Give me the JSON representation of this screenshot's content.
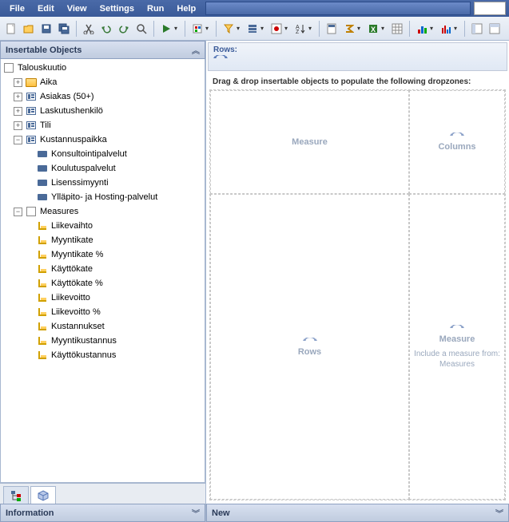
{
  "menu": [
    "File",
    "Edit",
    "View",
    "Settings",
    "Run",
    "Help"
  ],
  "panels": {
    "insertable": "Insertable Objects",
    "information": "Information",
    "new": "New"
  },
  "tree": {
    "root": "Talouskuutio",
    "items": [
      {
        "label": "Aika",
        "toggle": "+",
        "icon": "folder",
        "depth": 1
      },
      {
        "label": "Asiakas (50+)",
        "toggle": "+",
        "icon": "dim",
        "depth": 1
      },
      {
        "label": "Laskutushenkilö",
        "toggle": "+",
        "icon": "dim",
        "depth": 1
      },
      {
        "label": "Tili",
        "toggle": "+",
        "icon": "dim",
        "depth": 1
      },
      {
        "label": "Kustannuspaikka",
        "toggle": "−",
        "icon": "dim",
        "depth": 1
      },
      {
        "label": "Konsultointipalvelut",
        "toggle": "",
        "icon": "member",
        "depth": 2
      },
      {
        "label": "Koulutuspalvelut",
        "toggle": "",
        "icon": "member",
        "depth": 2
      },
      {
        "label": "Lisenssimyynti",
        "toggle": "",
        "icon": "member",
        "depth": 2
      },
      {
        "label": "Ylläpito- ja Hosting-palvelut",
        "toggle": "",
        "icon": "member",
        "depth": 2
      },
      {
        "label": "Measures",
        "toggle": "−",
        "icon": "measures",
        "depth": 1
      },
      {
        "label": "Liikevaihto",
        "toggle": "",
        "icon": "measure",
        "depth": 2
      },
      {
        "label": "Myyntikate",
        "toggle": "",
        "icon": "measure",
        "depth": 2
      },
      {
        "label": "Myyntikate %",
        "toggle": "",
        "icon": "measure",
        "depth": 2
      },
      {
        "label": "Käyttökate",
        "toggle": "",
        "icon": "measure",
        "depth": 2
      },
      {
        "label": "Käyttökate %",
        "toggle": "",
        "icon": "measure",
        "depth": 2
      },
      {
        "label": "Liikevoitto",
        "toggle": "",
        "icon": "measure",
        "depth": 2
      },
      {
        "label": "Liikevoitto %",
        "toggle": "",
        "icon": "measure",
        "depth": 2
      },
      {
        "label": "Kustannukset",
        "toggle": "",
        "icon": "measure",
        "depth": 2
      },
      {
        "label": "Myyntikustannus",
        "toggle": "",
        "icon": "measure",
        "depth": 2
      },
      {
        "label": "Käyttökustannus",
        "toggle": "",
        "icon": "measure",
        "depth": 2
      }
    ]
  },
  "rowsbar": {
    "label": "Rows:"
  },
  "hint": "Drag & drop insertable objects to populate the following dropzones:",
  "dropzones": {
    "measure_tl": "Measure",
    "columns": "Columns",
    "rows": "Rows",
    "measure_br": "Measure",
    "measure_sub": "Include a measure from: Measures"
  }
}
